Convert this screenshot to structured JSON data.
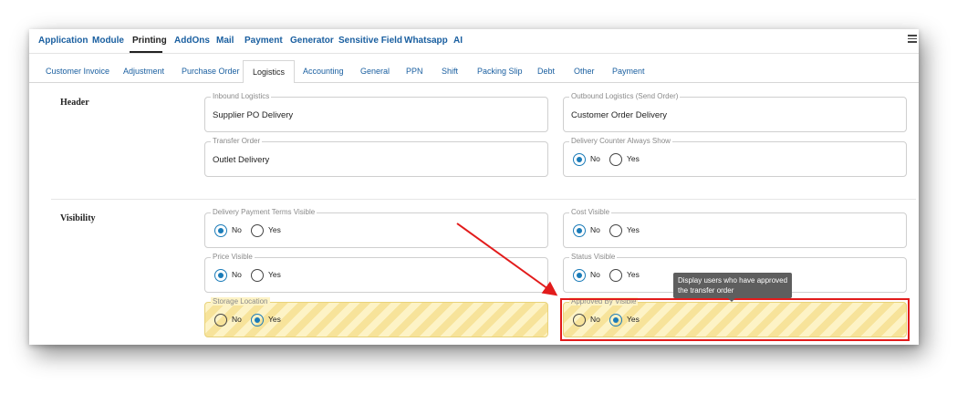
{
  "top_menu": {
    "items": [
      "Application",
      "Module",
      "Printing",
      "AddOns",
      "Mail",
      "Payment",
      "Generator",
      "Sensitive Field",
      "Whatsapp",
      "AI"
    ],
    "active": "Printing"
  },
  "tabs": {
    "items": [
      "Customer Invoice",
      "Adjustment",
      "Purchase Order",
      "Logistics",
      "Accounting",
      "General",
      "PPN",
      "Shift",
      "Packing Slip",
      "Debt",
      "Other",
      "Payment"
    ],
    "active": "Logistics"
  },
  "header_section": {
    "title": "Header",
    "inbound_label": "Inbound Logistics",
    "inbound_value": "Supplier PO Delivery",
    "outbound_label": "Outbound Logistics (Send Order)",
    "outbound_value": "Customer Order Delivery",
    "transfer_label": "Transfer Order",
    "transfer_value": "Outlet Delivery",
    "delivery_counter_label": "Delivery Counter Always Show",
    "delivery_counter_selected": "No"
  },
  "visibility_section": {
    "title": "Visibility",
    "delivery_payment_label": "Delivery Payment Terms Visible",
    "delivery_payment_selected": "No",
    "cost_label": "Cost Visible",
    "cost_selected": "No",
    "price_label": "Price Visible",
    "price_selected": "No",
    "status_label": "Status Visible",
    "status_selected": "No",
    "storage_label": "Storage Location",
    "storage_selected": "Yes",
    "approved_label": "Approved By Visible",
    "approved_selected": "Yes"
  },
  "radio": {
    "no": "No",
    "yes": "Yes"
  },
  "tooltip": {
    "line1": "Display users who have approved",
    "line2": "the transfer order"
  },
  "colors": {
    "link": "#1a5fa0",
    "radio_checked": "#1a7bb8",
    "annotation_red": "#e21b1b",
    "stripe_light": "#fdf3c6",
    "stripe_dark": "#f7e39a",
    "tooltip_bg": "#5e5e5e"
  },
  "icons": {
    "menu": "hamburger-menu-icon"
  }
}
